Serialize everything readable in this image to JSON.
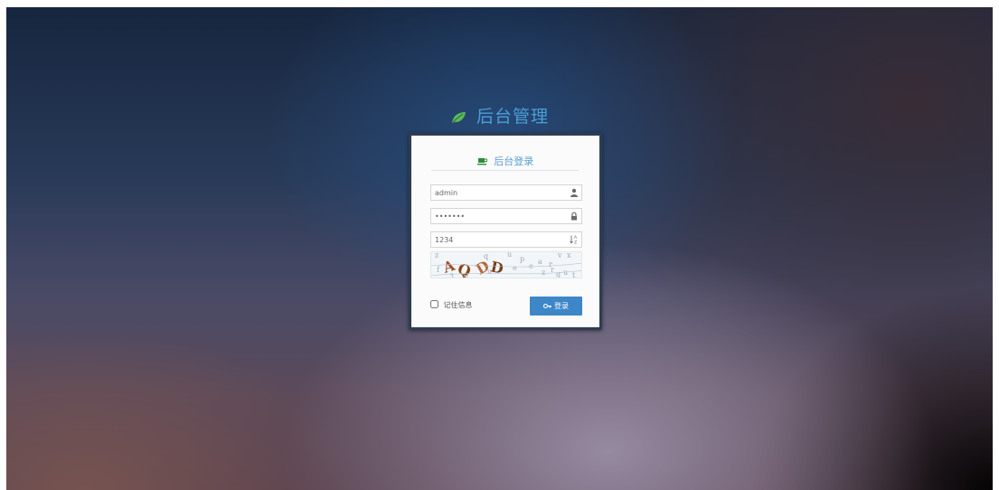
{
  "brand": {
    "title": "后台管理",
    "icon": "leaf-icon",
    "color": "#4a9fd8"
  },
  "login": {
    "title": "后台登录",
    "title_icon": "coffee-icon",
    "username": {
      "value": "admin",
      "icon": "user-icon"
    },
    "password": {
      "value": "1234567",
      "icon": "lock-icon"
    },
    "captcha_field": {
      "value": "1234",
      "icon": "sort-alpha-icon"
    },
    "remember_label": "记住信息",
    "remember_checked": false,
    "login_button_label": "登录",
    "login_button_icon": "key-icon",
    "button_color": "#3d87c8"
  }
}
